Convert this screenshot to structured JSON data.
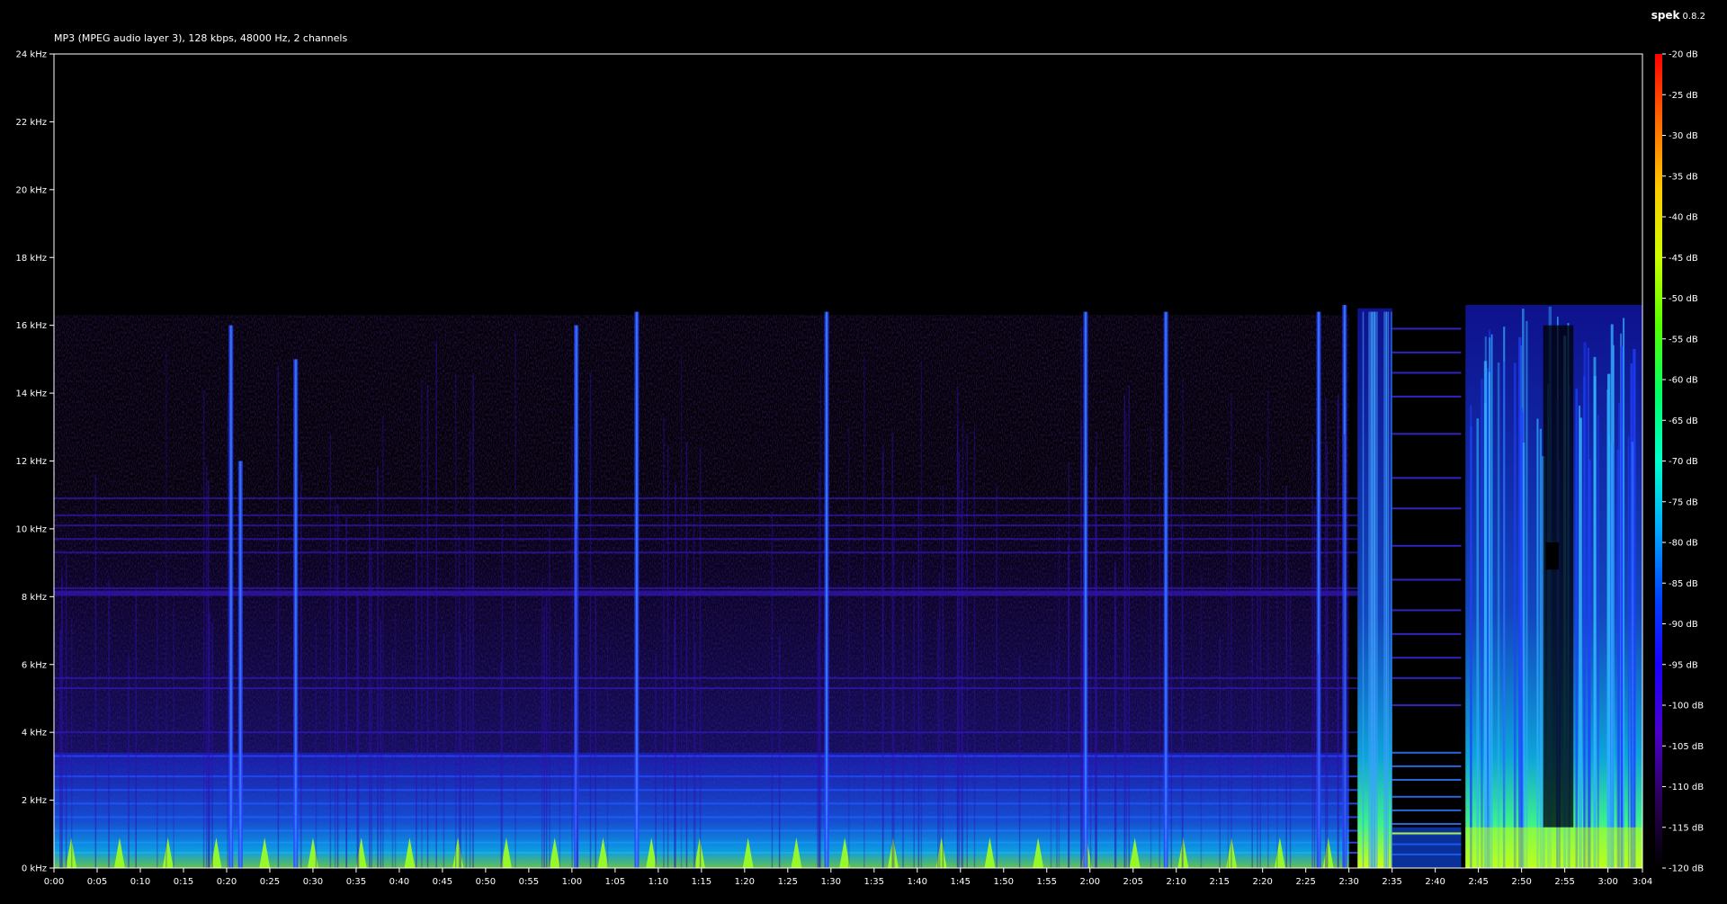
{
  "app": {
    "name": "spek",
    "version": "0.8.2"
  },
  "file_info": "MP3 (MPEG audio layer 3), 128 kbps, 48000 Hz, 2 channels",
  "frequency_axis": {
    "labels": [
      "0 kHz",
      "2 kHz",
      "4 kHz",
      "6 kHz",
      "8 kHz",
      "10 kHz",
      "12 kHz",
      "14 kHz",
      "16 kHz",
      "18 kHz",
      "20 kHz",
      "22 kHz",
      "24 kHz"
    ],
    "min_khz": 0,
    "max_khz": 24
  },
  "time_axis": {
    "labels": [
      "0:00",
      "0:05",
      "0:10",
      "0:15",
      "0:20",
      "0:25",
      "0:30",
      "0:35",
      "0:40",
      "0:45",
      "0:50",
      "0:55",
      "1:00",
      "1:05",
      "1:10",
      "1:15",
      "1:20",
      "1:25",
      "1:30",
      "1:35",
      "1:40",
      "1:45",
      "1:50",
      "1:55",
      "2:00",
      "2:05",
      "2:10",
      "2:15",
      "2:20",
      "2:25",
      "2:30",
      "2:35",
      "2:40",
      "2:45",
      "2:50",
      "2:55",
      "3:00",
      "3:04"
    ],
    "duration_seconds": 184
  },
  "db_scale": {
    "labels": [
      "-20 dB",
      "-25 dB",
      "-30 dB",
      "-35 dB",
      "-40 dB",
      "-45 dB",
      "-50 dB",
      "-55 dB",
      "-60 dB",
      "-65 dB",
      "-70 dB",
      "-75 dB",
      "-80 dB",
      "-85 dB",
      "-90 dB",
      "-95 dB",
      "-100 dB",
      "-105 dB",
      "-110 dB",
      "-115 dB",
      "-120 dB"
    ],
    "max_db": -20,
    "min_db": -120,
    "gradient_colors": [
      "#ff0000",
      "#ff6a00",
      "#ffcc00",
      "#ccff00",
      "#55ff00",
      "#00ff66",
      "#00ffcc",
      "#00aaff",
      "#0044ff",
      "#1a00ff",
      "#4a00cc",
      "#2a0055",
      "#000000"
    ]
  }
}
